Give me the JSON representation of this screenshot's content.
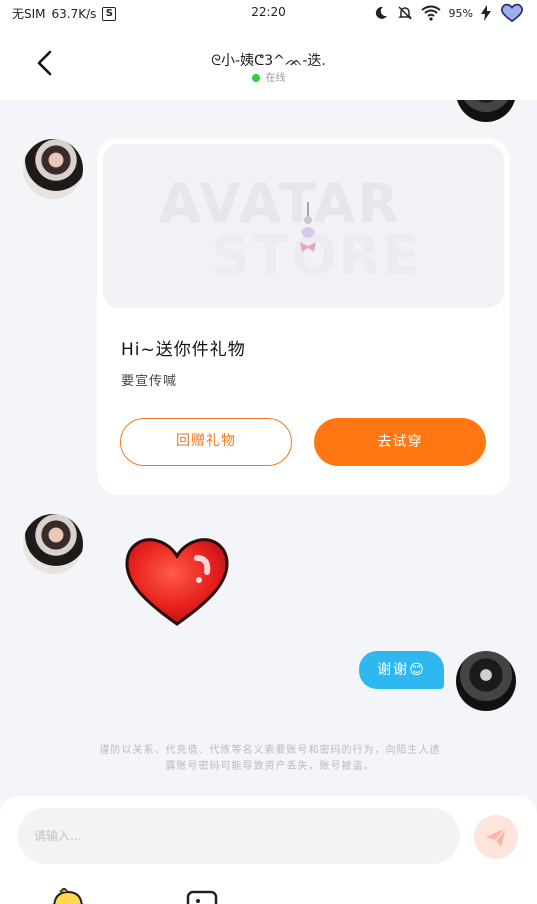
{
  "status_bar": {
    "carrier": "无SIM",
    "network_speed": "63.7K/s",
    "s_badge": "S",
    "time": "22:20",
    "battery": "95%",
    "icons": [
      "moon-icon",
      "mute-bell-icon",
      "wifi-icon",
      "charging-bolt-icon",
      "heart-battery-icon"
    ]
  },
  "header": {
    "title": "ᘓ小-姨ᕦ3^ᨏ-迭.",
    "status": "在线",
    "online_color": "#2ecc40"
  },
  "gift_card": {
    "banner_word_1": "AVATAR",
    "banner_word_2": "STORE",
    "title": "Hi~送你件礼物",
    "subtitle": "要宣传喊",
    "return_gift_button": "回赠礼物",
    "try_on_button": "去试穿",
    "accent_color": "#ff7613"
  },
  "messages": {
    "sent_text": "谢谢",
    "sent_emoji": "😊",
    "bubble_color": "#2fb8f0"
  },
  "notice": {
    "line1": "谨防以关系、代充值、代练等名义索要账号和密码的行为，向陌生人透",
    "line2": "露账号密码可能导致资产丢失，账号被盗。"
  },
  "input": {
    "placeholder": "请输入..."
  }
}
